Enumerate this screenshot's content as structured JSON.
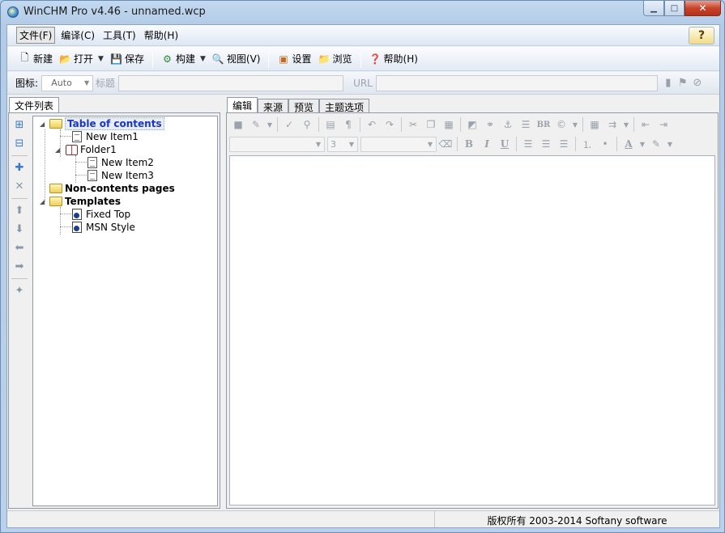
{
  "window": {
    "title": "WinCHM Pro v4.46 - unnamed.wcp"
  },
  "menu": {
    "items": [
      "文件(F)",
      "编译(C)",
      "工具(T)",
      "帮助(H)"
    ]
  },
  "toolbar": {
    "new_label": "新建",
    "open_label": "打开",
    "save_label": "保存",
    "build_label": "构建",
    "view_label": "视图(V)",
    "settings_label": "设置",
    "browse_label": "浏览",
    "help_label": "帮助(H)"
  },
  "properties": {
    "icon_label": "图标:",
    "icon_value": "Auto",
    "title_label": "标题",
    "url_label": "URL"
  },
  "left_tabs": [
    "文件列表"
  ],
  "tree": {
    "toc": "Table of contents",
    "item1": "New Item1",
    "folder1": "Folder1",
    "item2": "New Item2",
    "item3": "New Item3",
    "noncontents": "Non-contents pages",
    "templates": "Templates",
    "fixed_top": "Fixed Top",
    "msn_style": "MSN Style"
  },
  "editor_tabs": [
    "编辑",
    "来源",
    "预览",
    "主题选项"
  ],
  "editor_toolbar": {
    "br_label": "BR",
    "font_size_value": "3",
    "bold_label": "B",
    "italic_label": "I",
    "underline_label": "U",
    "fontcolor_label": "A"
  },
  "status": {
    "copyright": "版权所有 2003-2014 Softany software"
  }
}
